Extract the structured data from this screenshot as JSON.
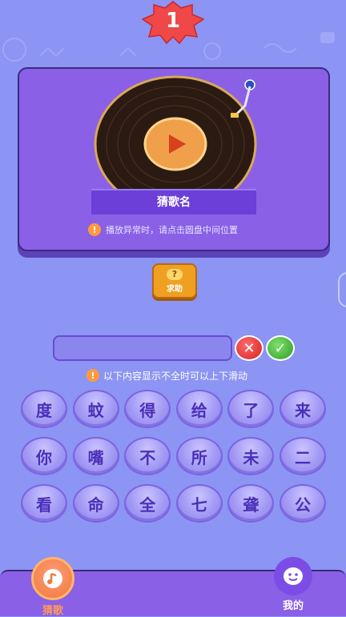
{
  "level": {
    "number": "1"
  },
  "player": {
    "song_label": "猜歌名",
    "notice_text": "播放异常时，请点击圆盘中间位置"
  },
  "help": {
    "label": "求助",
    "icon_glyph": "?"
  },
  "answer": {
    "value": ""
  },
  "hint": {
    "text": "以下内容显示不全时可以上下滑动"
  },
  "chars": [
    [
      "度",
      "蚊",
      "得",
      "给",
      "了",
      "来"
    ],
    [
      "你",
      "嘴",
      "不",
      "所",
      "未",
      "二"
    ],
    [
      "看",
      "命",
      "全",
      "七",
      "聋",
      "公"
    ]
  ],
  "nav": {
    "guess_label": "猜歌",
    "mine_label": "我的"
  },
  "colors": {
    "background": "#8c94f4",
    "card": "#8a60e6",
    "badge": "#f04848",
    "accent_orange": "#f0a020"
  }
}
